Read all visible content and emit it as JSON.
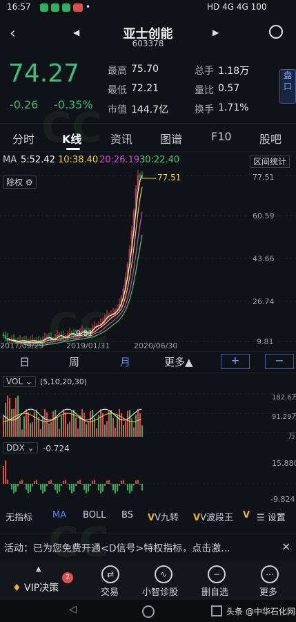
{
  "status_bar": {
    "time": "16:57",
    "right": "HD 4G 4G 100"
  },
  "header": {
    "name": "亚士创能",
    "code": "603378"
  },
  "quote": {
    "price": "74.27",
    "change": "-0.26",
    "change_pct": "-0.35%",
    "high_label": "最高",
    "high": "75.70",
    "low_label": "最低",
    "low": "72.21",
    "cap_label": "市值",
    "cap": "144.7亿",
    "vol_label": "总手",
    "vol": "1.18万",
    "ratio_label": "量比",
    "ratio": "0.57",
    "turn_label": "换手",
    "turn": "1.71%",
    "panko": "盘口"
  },
  "tabs": [
    "分时",
    "K线",
    "资讯",
    "图谱",
    "F10",
    "股吧"
  ],
  "ma_line": {
    "label": "MA",
    "ma5": "5:52.42",
    "ma10": "10:38.40",
    "ma20": "20:26.19",
    "ma30": "30:22.40",
    "stats_button": "区间统计"
  },
  "chart": {
    "adjust_button": "除权",
    "y_ticks": [
      "77.51",
      "60.59",
      "43.66",
      "26.74",
      "9.81"
    ],
    "x_dates": [
      "2017/09/29",
      "2019/01/31",
      "2020/06/30"
    ],
    "last_label": "77.51",
    "low_label": "9.81",
    "colors": {
      "up": "#e24b4b",
      "down": "#2fb35c",
      "ma5": "#ffffff",
      "ma10": "#f2d13b",
      "ma20": "#d44ad4",
      "ma30": "#43d36a"
    }
  },
  "periods": {
    "day": "日",
    "week": "周",
    "month": "月",
    "more": "更多▲",
    "zoom_in": "+",
    "zoom_out": "−"
  },
  "vol_panel": {
    "label": "VOL",
    "params": "(5,10,20,30)",
    "ticks": [
      "182.6万",
      "91.29万",
      "万"
    ]
  },
  "ddx_panel": {
    "label": "DDX",
    "value": "-0.724",
    "ticks": [
      "15.880",
      "-9.824"
    ]
  },
  "indicators": [
    "无指标",
    "MA",
    "BOLL",
    "BS",
    "V九转",
    "V波段王",
    "V",
    "设置"
  ],
  "notice": {
    "text": "活动：已为您免费开通<D信号>特权指标，点击激...",
    "close": "×"
  },
  "bottom_nav": {
    "vip": "VIP决策",
    "vip_badge": "2",
    "trade": "交易",
    "diagnose": "小智诊股",
    "delete": "删自选",
    "more": "更多"
  },
  "watermark": {
    "source": "头条 @中华石化网"
  }
}
